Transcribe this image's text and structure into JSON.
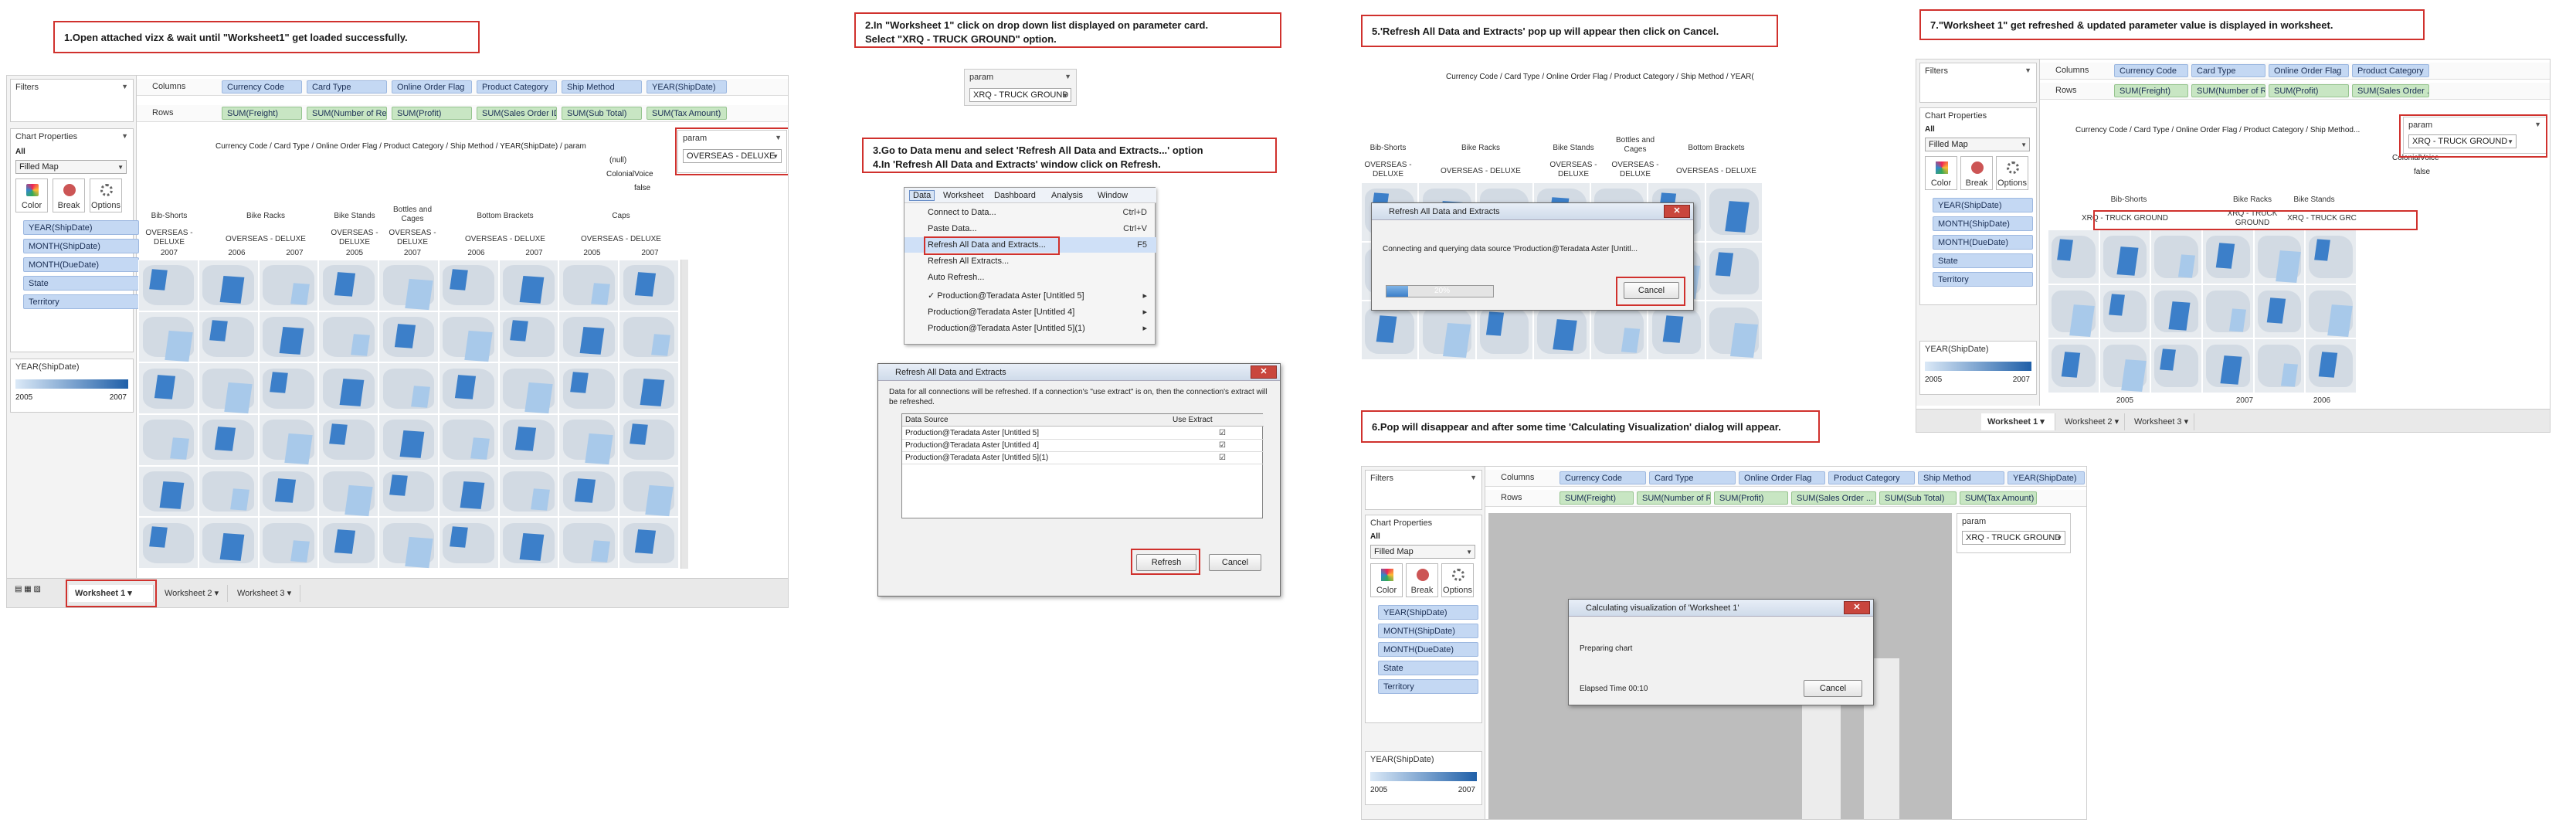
{
  "steps": {
    "s1": "1.Open attached vizx & wait until \"Worksheet1\" get loaded successfully.",
    "s2": "2.In \"Worksheet 1\" click on drop down list displayed on parameter card.\n   Select \"XRQ - TRUCK GROUND\" option.",
    "s3": "3.Go to Data menu and select 'Refresh All Data and Extracts...' option\n4.In 'Refresh All Data and Extracts' window click on Refresh.",
    "s5": "5.'Refresh All Data and Extracts' pop up will appear then click on Cancel.",
    "s6": "6.Pop will disappear and after some time 'Calculating Visualization' dialog will appear.",
    "s7": "7.\"Worksheet 1\" get refreshed & updated parameter value is displayed in worksheet."
  },
  "ui": {
    "filters": "Filters",
    "columns": "Columns",
    "rows": "Rows",
    "marks": "Chart Properties",
    "all": "All",
    "mark_type": "Filled Map",
    "color": "Color",
    "break": "Break",
    "options": "Options",
    "legend_title": "YEAR(ShipDate)",
    "legend_min": "2005",
    "legend_max": "2007",
    "param_title": "param",
    "param_value_1": "OVERSEAS - DELUXE",
    "param_value_2": "XRQ - TRUCK GROUND",
    "null": "(null)",
    "colonial": "ColonialVoice",
    "false": "false",
    "header_path": "Currency Code / Card Type / Online Order Flag / Product Category / Ship Method / YEAR(ShipDate) / param",
    "header_path_short": "Currency Code / Card Type / Online Order Flag / Product Category / Ship Method / YEAR(",
    "header_path_7": "Currency Code / Card Type / Online Order Flag / Product Category / Ship Method..."
  },
  "columns_pills": [
    "Currency Code",
    "Card Type",
    "Online Order Flag",
    "Product Category",
    "Ship Method",
    "YEAR(ShipDate)"
  ],
  "rows_pills": [
    "SUM(Freight)",
    "SUM(Number of Re...",
    "SUM(Profit)",
    "SUM(Sales Order ID)",
    "SUM(Sub Total)",
    "SUM(Tax Amount)"
  ],
  "rows_pills_6": [
    "SUM(Freight)",
    "SUM(Number of R...",
    "SUM(Profit)",
    "SUM(Sales Order ...",
    "SUM(Sub Total)",
    "SUM(Tax Amount)"
  ],
  "marks_pills": [
    "YEAR(ShipDate)",
    "MONTH(ShipDate)",
    "MONTH(DueDate)",
    "State",
    "Territory"
  ],
  "sheet_tabs": [
    "Worksheet 1",
    "Worksheet 2",
    "Worksheet 3"
  ],
  "categories": [
    "Bib-Shorts",
    "Bike Racks",
    "Bike Stands",
    "Bottles and Cages",
    "Bottom Brackets",
    "Caps"
  ],
  "ship_label": "OVERSEAS - DELUXE",
  "years1": [
    "2007",
    "2006",
    "2007",
    "2005",
    "2007",
    "2006",
    "2007",
    "2005",
    "2007"
  ],
  "data_menu": {
    "bar": [
      "Data",
      "Worksheet",
      "Dashboard",
      "Analysis",
      "Window"
    ],
    "items": [
      {
        "label": "Connect to Data...",
        "sc": "Ctrl+D"
      },
      {
        "label": "Paste Data...",
        "sc": "Ctrl+V"
      },
      {
        "label": "Refresh All Data and Extracts...",
        "sc": "F5"
      },
      {
        "label": "Refresh All Extracts...",
        "sc": ""
      },
      {
        "label": "Auto Refresh...",
        "sc": ""
      },
      {
        "label": "✓ Production@Teradata Aster [Untitled 5]",
        "sc": "▸"
      },
      {
        "label": "Production@Teradata Aster [Untitled 4]",
        "sc": "▸"
      },
      {
        "label": "Production@Teradata Aster [Untitled 5](1)",
        "sc": "▸"
      }
    ]
  },
  "refresh_dialog": {
    "title": "Refresh All Data and Extracts",
    "desc": "Data for all connections will be refreshed. If a connection's \"use extract\" is on, then the connection's extract will be refreshed.",
    "col_source": "Data Source",
    "col_extract": "Use Extract",
    "rows": [
      "Production@Teradata Aster [Untitled 5]",
      "Production@Teradata Aster [Untitled 4]",
      "Production@Teradata Aster [Untitled 5](1)"
    ],
    "refresh": "Refresh",
    "cancel": "Cancel"
  },
  "progress_dialog": {
    "title": "Refresh All Data and Extracts",
    "text": "Connecting and querying data source 'Production@Teradata Aster [Untitl...",
    "percent": "20%",
    "cancel": "Cancel"
  },
  "calc_dialog": {
    "title": "Calculating visualization of 'Worksheet 1'",
    "text": "Preparing chart",
    "elapsed": "Elapsed Time 00:10",
    "cancel": "Cancel"
  },
  "xrq_labels": [
    "XRQ - TRUCK GROUND",
    "XRQ - TRUCK GROUND",
    "XRQ - TRUCK GRC"
  ],
  "years7": [
    "2005",
    "2007",
    "2006"
  ],
  "cats7": [
    "Bib-Shorts",
    "Bike Racks",
    "Bike Stands"
  ],
  "cats5": [
    "Bib-Shorts",
    "Bike Racks",
    "Bike Stands",
    "Bottles and Cages",
    "Bottom Brackets"
  ],
  "ship_short": "OVERSEAS - DELUXE",
  "param_short_2": "XRQ - TRUCK GROUND"
}
